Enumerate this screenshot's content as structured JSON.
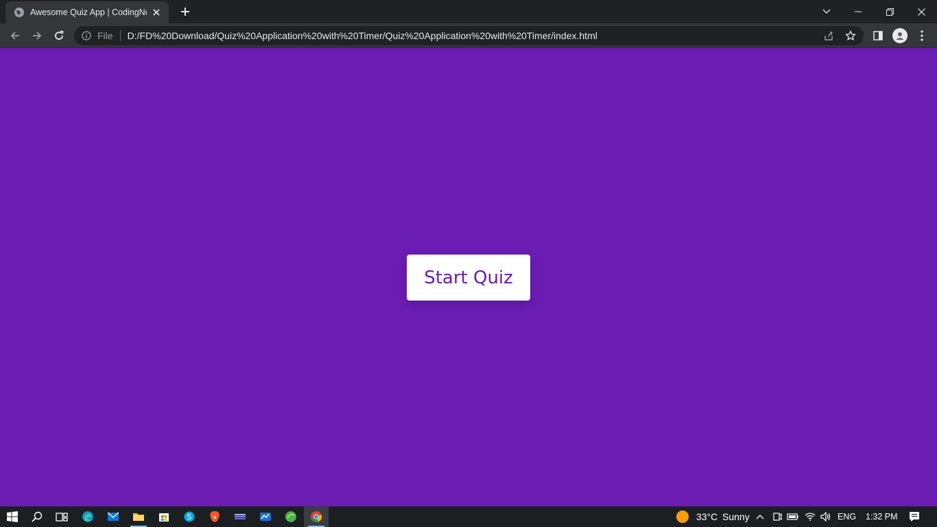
{
  "browser": {
    "tab": {
      "title": "Awesome Quiz App | CodingNepal"
    },
    "address_bar": {
      "scheme_label": "File",
      "url": "D:/FD%20Download/Quiz%20Application%20with%20Timer/Quiz%20Application%20with%20Timer/index.html"
    }
  },
  "page": {
    "background_color": "#6a1cb3",
    "start_button_label": "Start Quiz"
  },
  "taskbar": {
    "weather_temp": "33°C",
    "weather_desc": "Sunny",
    "language": "ENG",
    "time": "1:32 PM",
    "pinned_apps": [
      "windows-start-icon",
      "search-icon",
      "task-view-icon",
      "edge-icon",
      "mail-icon",
      "file-explorer-icon",
      "microsoft-store-icon",
      "skype-icon",
      "brave-icon",
      "app-icon",
      "app-icon",
      "app-icon",
      "chrome-icon"
    ]
  }
}
